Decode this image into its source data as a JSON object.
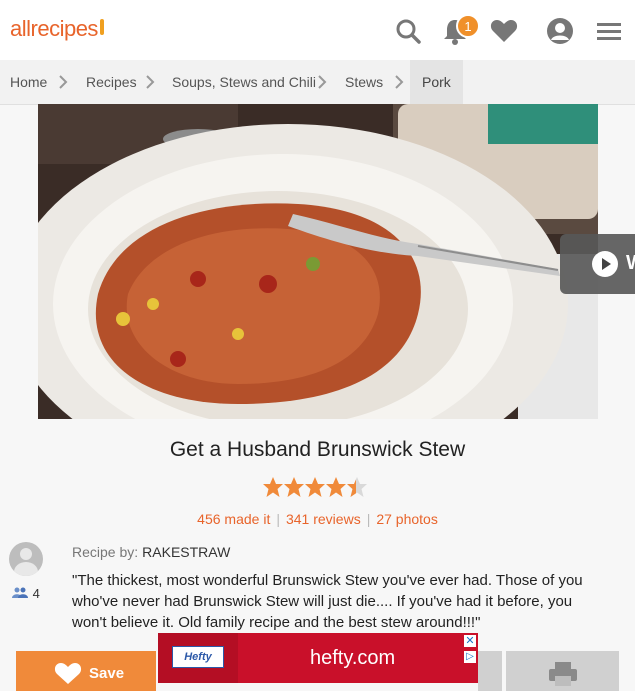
{
  "header": {
    "logo": "allrecipes",
    "notification_count": "1",
    "icons": [
      "search-icon",
      "bell-icon",
      "heart-icon",
      "profile-icon",
      "menu-icon"
    ]
  },
  "breadcrumb": {
    "items": [
      "Home",
      "Recipes",
      "Soups, Stews and Chili",
      "Stews",
      "Pork"
    ]
  },
  "video": {
    "label": "W"
  },
  "recipe": {
    "title": "Get a Husband Brunswick Stew",
    "rating": 4.5,
    "made_it": "456 made it",
    "reviews": "341 reviews",
    "photos": "27 photos",
    "recipe_by_label": "Recipe by:",
    "author": "RAKESTRAW",
    "followers": "4",
    "description": "\"The thickest, most wonderful Brunswick Stew you've ever had. Those of you who've never had Brunswick Stew will just die.... If you've had it before, you won't believe it. Old family recipe and the best stew around!!!\""
  },
  "actions": {
    "save_label": "Save"
  },
  "ad": {
    "brand": "Hefty",
    "text": "hefty.com",
    "close": "✕",
    "info": "▷"
  },
  "colors": {
    "accent": "#e8642b",
    "save": "#f08a3a",
    "ad": "#c9102a",
    "star": "#f08a3a"
  }
}
